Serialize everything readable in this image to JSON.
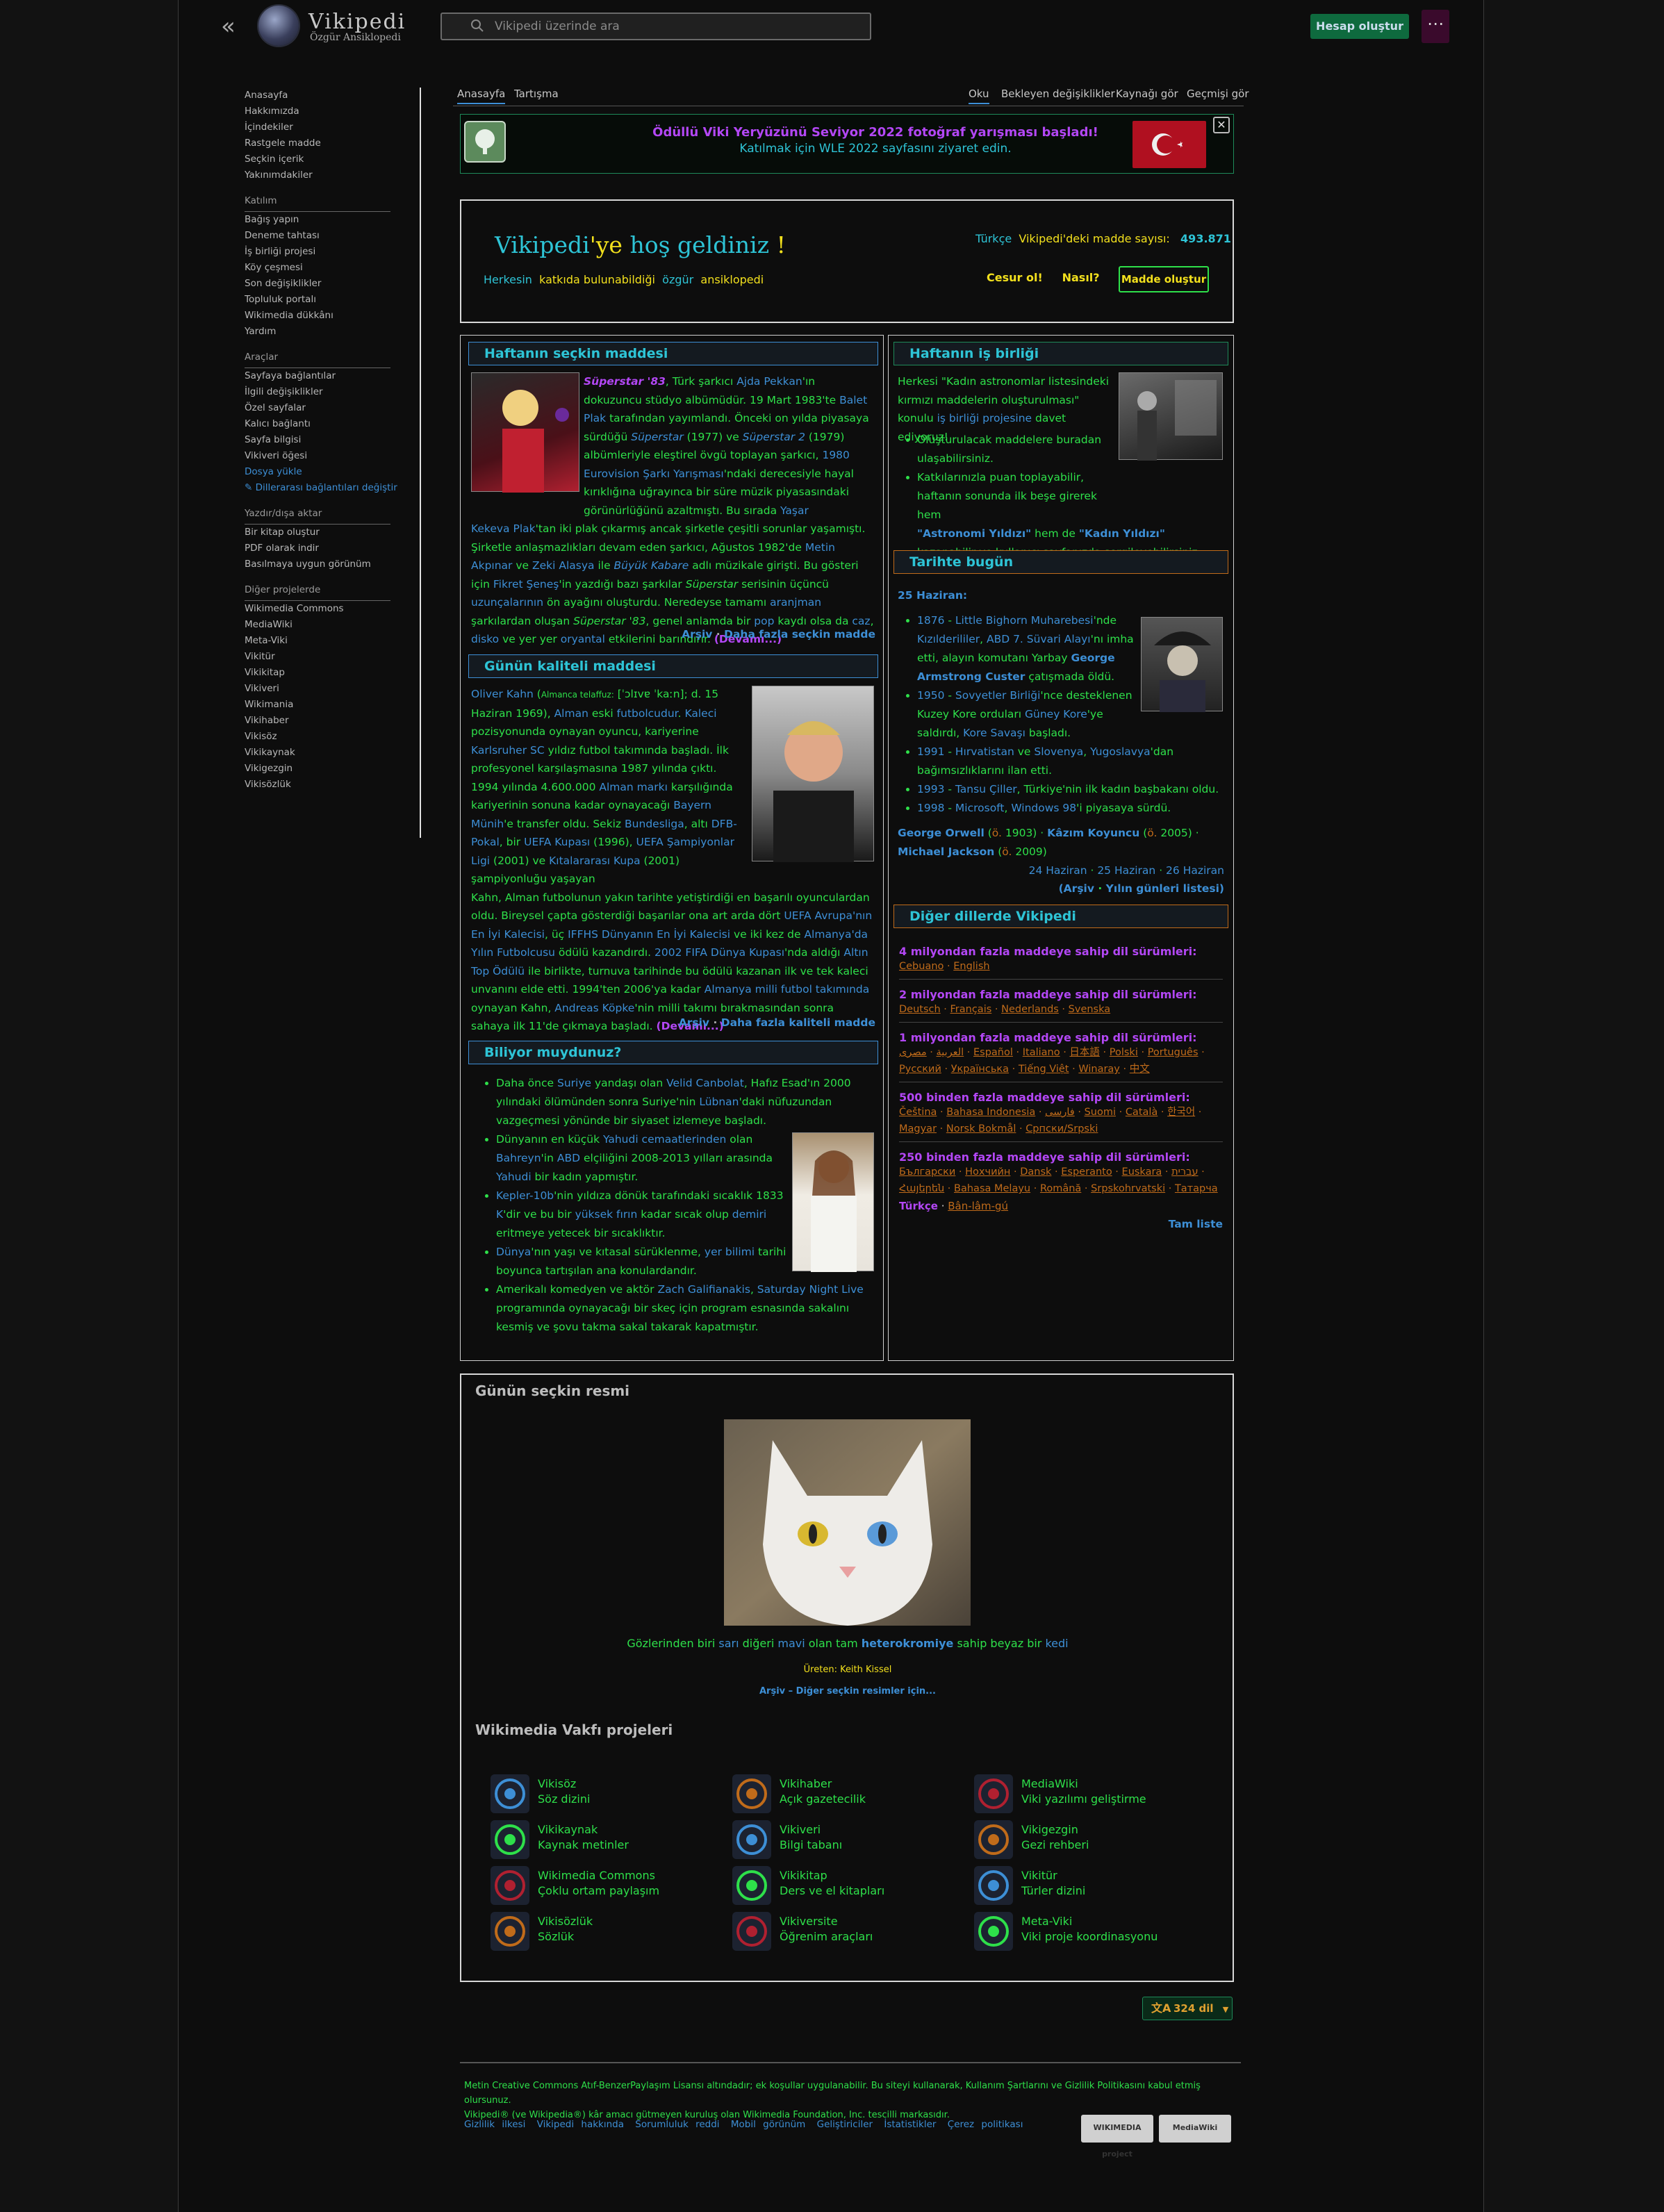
{
  "header": {
    "logo_title": "Vikipedi",
    "logo_subtitle": "Özgür Ansiklopedi",
    "search_placeholder": "Vikipedi üzerinde ara",
    "create_account": "Hesap oluştur",
    "more": "⋯"
  },
  "sidebar": {
    "main": [
      "Anasayfa",
      "Hakkımızda",
      "İçindekiler",
      "Rastgele madde",
      "Seçkin içerik",
      "Yakınımdakiler"
    ],
    "katilim_head": "Katılım",
    "katilim": [
      "Bağış yapın",
      "Deneme tahtası",
      "İş birliği projesi",
      "Köy çeşmesi",
      "Son değişiklikler",
      "Topluluk portalı",
      "Wikimedia dükkânı",
      "Yardım"
    ],
    "araclar_head": "Araçlar",
    "araclar": [
      "Sayfaya bağlantılar",
      "İlgili değişiklikler",
      "Özel sayfalar",
      "Kalıcı bağlantı",
      "Sayfa bilgisi",
      "Vikiveri öğesi"
    ],
    "upload": "Dosya yükle",
    "edit_links": "✎ Dillerarası bağlantıları değiştir",
    "yazdir_head": "Yazdır/dışa aktar",
    "yazdir": [
      "Bir kitap oluştur",
      "PDF olarak indir",
      "Basılmaya uygun görünüm"
    ],
    "diger_head": "Diğer projelerde",
    "diger": [
      "Wikimedia Commons",
      "MediaWiki",
      "Meta-Viki",
      "Vikitür",
      "Vikikitap",
      "Vikiveri",
      "Wikimania",
      "Vikihaber",
      "Vikisöz",
      "Vikikaynak",
      "Vikigezgin",
      "Vikisözlük"
    ]
  },
  "tabs": {
    "left": [
      "Anasayfa",
      "Tartışma"
    ],
    "right": [
      "Oku",
      "Bekleyen değişiklikler",
      "Kaynağı gör",
      "Geçmişi gör"
    ]
  },
  "banner": {
    "line1": "Ödüllü Viki Yeryüzünü Seviyor 2022 fotoğraf yarışması başladı!",
    "line2": "Katılmak için WLE 2022 sayfasını ziyaret edin.",
    "close": "✕"
  },
  "welcome": {
    "t1": "Vikipedi",
    "t2": "'ye",
    "t3": "hoş geldiniz",
    "t4": "!",
    "s1": "Herkesin",
    "s2": "katkıda bulunabildiği",
    "s3": "özgür",
    "s4": "ansiklopedi",
    "c1": "Türkçe",
    "c2": "Vikipedi'deki madde sayısı:",
    "c3": "493.871",
    "bold1": "Cesur ol!",
    "bold2": "Nasıl?",
    "create": "Madde oluştur"
  },
  "featured": {
    "head": "Haftanın seçkin maddesi",
    "more": "(Devamı...)",
    "archive": "Arşiv",
    "morefeat": "Daha fazla seçkin madde"
  },
  "quality": {
    "head": "Günün kaliteli maddesi",
    "more": "(Devamı...)",
    "archive": "Arşiv",
    "moreq": "Daha fazla kaliteli madde"
  },
  "dyk": {
    "head": "Biliyor muydunuz?"
  },
  "collab": {
    "head": "Haftanın iş birliği"
  },
  "today": {
    "head": "Tarihte bugün",
    "date": "25 Haziran:",
    "nav1": "24 Haziran",
    "nav2": "25 Haziran",
    "nav3": "26 Haziran",
    "archive": "(Arşiv",
    "yearlist": "Yılın günleri listesi)"
  },
  "langs": {
    "head": "Diğer dillerde Vikipedi",
    "g1": "4 milyondan fazla maddeye sahip dil sürümleri:",
    "l1": [
      "Cebuano",
      "English"
    ],
    "g2": "2 milyondan fazla maddeye sahip dil sürümleri:",
    "l2": [
      "Deutsch",
      "Français",
      "Nederlands",
      "Svenska"
    ],
    "g3": "1 milyondan fazla maddeye sahip dil sürümleri:",
    "l3": [
      "العربية",
      "مصرى",
      "Español",
      "Italiano",
      "日本語",
      "Polski",
      "Português",
      "Русский",
      "Українська",
      "Tiếng Việt",
      "Winaray",
      "中文"
    ],
    "g4": "500 binden fazla maddeye sahip dil sürümleri:",
    "l4": [
      "Čeština",
      "Bahasa Indonesia",
      "فارسی",
      "Suomi",
      "Català",
      "한국어",
      "Magyar",
      "Norsk Bokmål",
      "Српски/Srpski"
    ],
    "g5": "250 binden fazla maddeye sahip dil sürümleri:",
    "l5": [
      "Български",
      "Нохчийн",
      "Dansk",
      "Esperanto",
      "Euskara",
      "עברית",
      "Հայերեն",
      "Bahasa Melayu",
      "Română",
      "Srpskohrvatski",
      "Татарча"
    ],
    "tr": "Türkçe",
    "banlam": "Bân-lâm-gú",
    "full": "Tam liste"
  },
  "picture": {
    "head": "Günün seçkin resmi",
    "author": "Üreten: Keith Kissel",
    "archive": "Arşiv – Diğer seçkin resimler için..."
  },
  "projects": {
    "head": "Wikimedia Vakfı projeleri",
    "items": [
      {
        "icon": "wikiquote-icon",
        "name": "Vikisöz",
        "desc": "Söz dizini"
      },
      {
        "icon": "wikinews-icon",
        "name": "Vikihaber",
        "desc": "Açık gazetecilik"
      },
      {
        "icon": "mediawiki-icon",
        "name": "MediaWiki",
        "desc": "Viki yazılımı geliştirme"
      },
      {
        "icon": "wikisource-icon",
        "name": "Vikikaynak",
        "desc": "Kaynak metinler"
      },
      {
        "icon": "wikidata-icon",
        "name": "Vikiveri",
        "desc": "Bilgi tabanı"
      },
      {
        "icon": "wikivoyage-icon",
        "name": "Vikigezgin",
        "desc": "Gezi rehberi"
      },
      {
        "icon": "commons-icon",
        "name": "Wikimedia Commons",
        "desc": "Çoklu ortam paylaşım"
      },
      {
        "icon": "wikibooks-icon",
        "name": "Vikikitap",
        "desc": "Ders ve el kitapları"
      },
      {
        "icon": "wikispecies-icon",
        "name": "Vikitür",
        "desc": "Türler dizini"
      },
      {
        "icon": "wiktionary-icon",
        "name": "Vikisözlük",
        "desc": "Sözlük"
      },
      {
        "icon": "wikiversity-icon",
        "name": "Vikiversite",
        "desc": "Öğrenim araçları"
      },
      {
        "icon": "meta-icon",
        "name": "Meta-Viki",
        "desc": "Viki proje koordinasyonu"
      }
    ]
  },
  "langbtn": "324 dil",
  "footer": {
    "line1": "Metin Creative Commons Atıf-BenzerPaylaşım Lisansı altındadır; ek koşullar uygulanabilir. Bu siteyi kullanarak, Kullanım Şartlarını ve Gizlilik Politikasını kabul etmiş olursunuz.",
    "line2": "Vikipedi® (ve Wikipedia®) kâr amacı gütmeyen kuruluş olan Wikimedia Foundation, Inc. tescilli markasıdır.",
    "links": [
      "Gizlilik ilkesi",
      "Vikipedi hakkında",
      "Sorumluluk reddi",
      "Mobil görünüm",
      "Geliştiriciler",
      "İstatistikler",
      "Çerez politikası"
    ],
    "logo1": "WIKIMEDIA project",
    "logo2": "MediaWiki"
  },
  "colors": {
    "green": "#2ee04a",
    "blue": "#3d8fd6",
    "cyan": "#2ec4d6",
    "purple": "#b347f5",
    "yellow": "#f2e01d",
    "orange": "#c06b1a"
  }
}
